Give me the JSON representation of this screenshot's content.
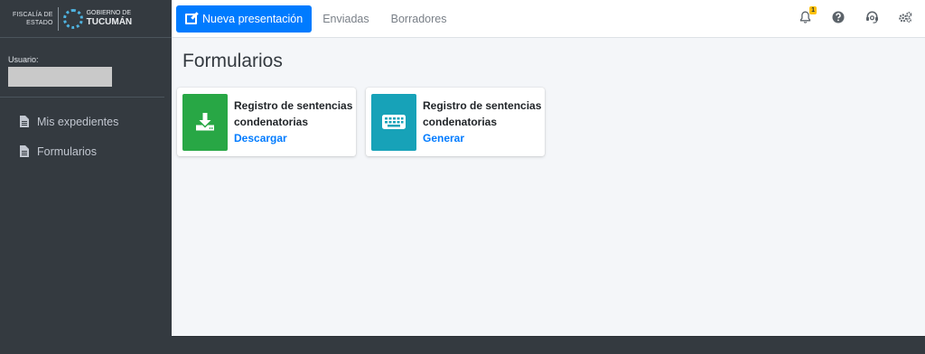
{
  "brand": {
    "fiscalia_line1": "FISCALÍA DE",
    "fiscalia_line2": "ESTADO",
    "gobierno_line1": "GOBIERNO DE",
    "gobierno_line2": "TUCUMÁN"
  },
  "user": {
    "label": "Usuario:"
  },
  "sidebar": {
    "items": [
      {
        "label": "Mis expedientes",
        "icon": "file-text-icon"
      },
      {
        "label": "Formularios",
        "icon": "file-text-icon"
      }
    ]
  },
  "topbar": {
    "new_label": "Nueva presentación",
    "links": [
      "Enviadas",
      "Borradores"
    ],
    "notifications_count": "1",
    "icons": [
      "bell-icon",
      "help-icon",
      "support-headset-icon",
      "settings-gears-icon"
    ]
  },
  "main": {
    "title": "Formularios",
    "cards": [
      {
        "title_line1": "Registro de sentencias",
        "title_line2": "condenatorias",
        "action": "Descargar",
        "icon": "download-icon",
        "color": "#28a745"
      },
      {
        "title_line1": "Registro de sentencias",
        "title_line2": "condenatorias",
        "action": "Generar",
        "icon": "keyboard-icon",
        "color": "#17a2b8"
      }
    ]
  },
  "colors": {
    "primary": "#007bff",
    "sidebar": "#343a40",
    "success": "#28a745",
    "info": "#17a2b8",
    "badge": "#ffc107"
  }
}
